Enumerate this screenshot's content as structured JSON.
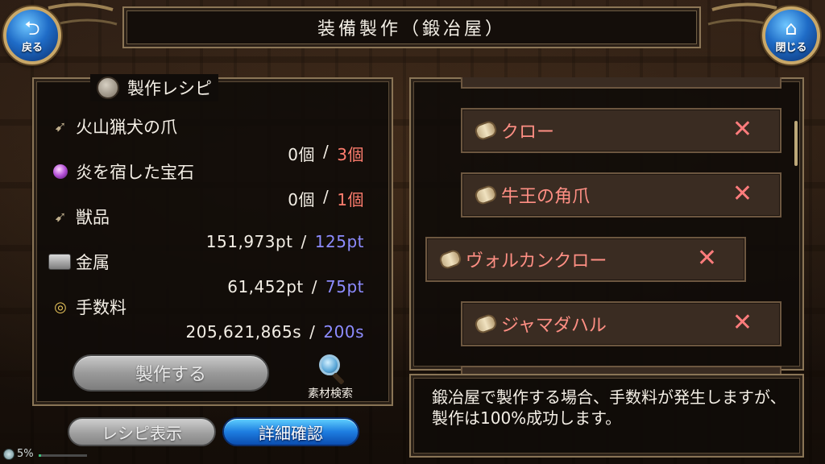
{
  "header": {
    "title": "装備製作（鍛冶屋）",
    "back_label": "戻る",
    "close_label": "閉じる"
  },
  "recipe": {
    "heading": "製作レシピ",
    "materials": [
      {
        "name": "火山猟犬の爪",
        "have": "0個",
        "need": "3個",
        "need_color": "red",
        "icon": "claw-icon"
      },
      {
        "name": "炎を宿した宝石",
        "have": "0個",
        "need": "1個",
        "need_color": "red",
        "icon": "gem-icon"
      },
      {
        "name": "獣品",
        "have": "151,973pt",
        "need": "125pt",
        "need_color": "blue",
        "icon": "claw-icon"
      },
      {
        "name": "金属",
        "have": "61,452pt",
        "need": "75pt",
        "need_color": "blue",
        "icon": "metal-ingot-icon"
      },
      {
        "name": "手数料",
        "have": "205,621,865s",
        "need": "200s",
        "need_color": "blue",
        "icon": "coins-icon"
      }
    ],
    "separator": "/",
    "craft_label": "製作する",
    "search_label": "素材検索",
    "recipe_view_label": "レシピ表示",
    "detail_label": "詳細確認"
  },
  "list": {
    "items": [
      {
        "label": "クロー",
        "icon": "scroll-icon"
      },
      {
        "label": "牛王の角爪",
        "icon": "scroll-icon"
      },
      {
        "label": "ヴォルカンクロー",
        "icon": "scroll-icon",
        "selected": true
      },
      {
        "label": "ジャマダハル",
        "icon": "scroll-icon"
      }
    ],
    "x_mark": "✕"
  },
  "message": {
    "text": "鍛冶屋で製作する場合、手数料が発生しますが、製作は100%成功します。"
  },
  "status": {
    "battery_percent": "5%",
    "battery_level": 0.05
  },
  "colors": {
    "need_red": "#ff7d6e",
    "need_blue": "#8d8cff",
    "list_label": "#ff8f84",
    "accent_blue": "#1e7de0"
  }
}
